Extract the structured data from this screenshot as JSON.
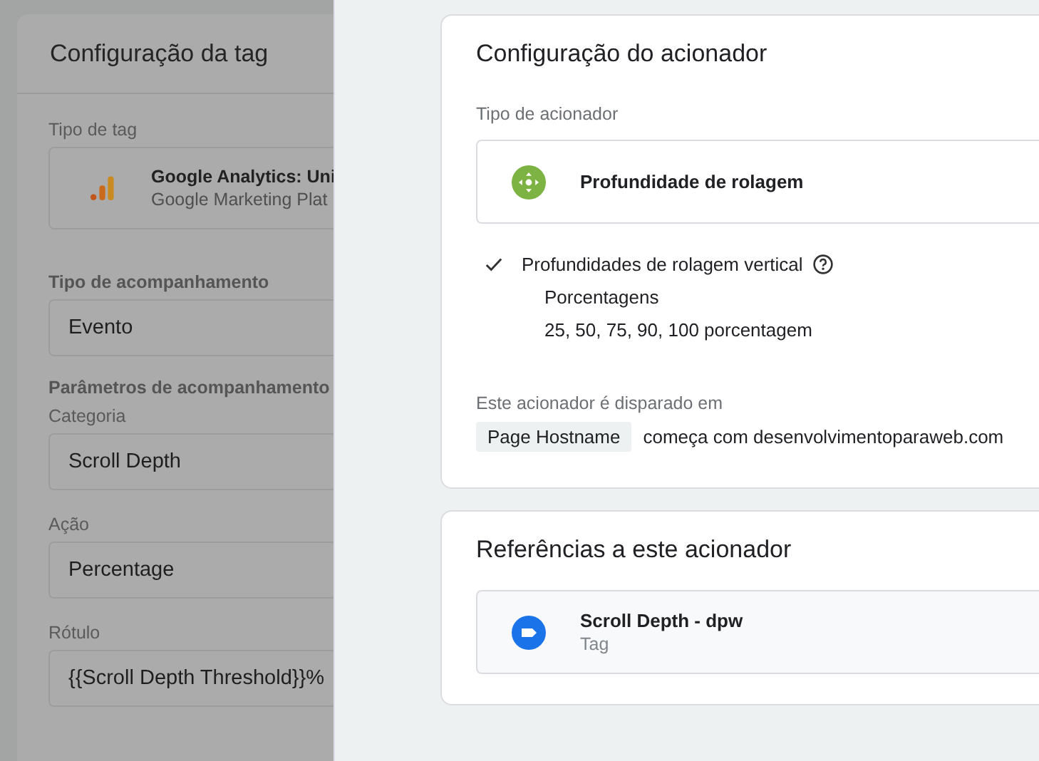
{
  "tag_panel": {
    "title": "Configuração da tag",
    "tag_type_label": "Tipo de tag",
    "tag_type": {
      "name": "Google Analytics: Uni",
      "vendor": "Google Marketing Plat"
    },
    "tracking_type_label": "Tipo de acompanhamento",
    "tracking_type": "Evento",
    "params_heading": "Parâmetros de acompanhamento",
    "fields": [
      {
        "label": "Categoria",
        "value": "Scroll Depth"
      },
      {
        "label": "Ação",
        "value": "Percentage"
      },
      {
        "label": "Rótulo",
        "value": "{{Scroll Depth Threshold}}%"
      }
    ]
  },
  "trigger_config": {
    "title": "Configuração do acionador",
    "type_label": "Tipo de acionador",
    "type_name": "Profundidade de rolagem",
    "option": {
      "checked": true,
      "label": "Profundidades de rolagem vertical",
      "sub_label": "Porcentagens",
      "values": "25, 50, 75, 90, 100 porcentagem"
    },
    "fires_on_label": "Este acionador é disparado em",
    "filter": {
      "variable": "Page Hostname",
      "condition": "começa com desenvolvimentoparaweb.com"
    }
  },
  "references": {
    "title": "Referências a este acionador",
    "items": [
      {
        "name": "Scroll Depth - dpw",
        "type": "Tag"
      }
    ]
  }
}
